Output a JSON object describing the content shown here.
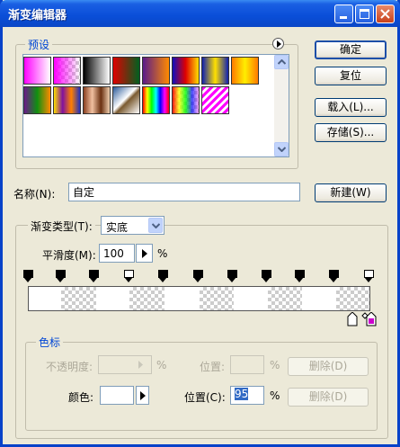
{
  "window": {
    "title": "渐变编辑器"
  },
  "presets": {
    "label": "预设",
    "swatches": [
      {
        "name": "magenta-white"
      },
      {
        "name": "magenta-transparent"
      },
      {
        "name": "black-white"
      },
      {
        "name": "red-green"
      },
      {
        "name": "violet-orange"
      },
      {
        "name": "blue-red-yellow"
      },
      {
        "name": "blue-yellow-blue"
      },
      {
        "name": "orange-yellow-orange"
      },
      {
        "name": "violet-green-orange"
      },
      {
        "name": "yellow-violet-orange-blue"
      },
      {
        "name": "copper"
      },
      {
        "name": "chrome"
      },
      {
        "name": "spectrum"
      },
      {
        "name": "transparent-rainbow"
      },
      {
        "name": "transparent-stripes"
      }
    ]
  },
  "buttons": {
    "ok": "确定",
    "reset": "复位",
    "load": "载入(L)...",
    "save": "存储(S)...",
    "new": "新建(W)"
  },
  "name": {
    "label": "名称(N):",
    "value": "自定"
  },
  "gradient_type": {
    "label": "渐变类型(T):",
    "value": "实底"
  },
  "smoothness": {
    "label": "平滑度(M):",
    "value": "100",
    "unit": "%"
  },
  "color_stops": {
    "label": "色标",
    "opacity_label": "不透明度:",
    "opacity_unit": "%",
    "opacity_location_label": "位置:",
    "opacity_location_unit": "%",
    "opacity_delete": "删除(D)",
    "color_label": "颜色:",
    "location_label": "位置(C):",
    "location_value": "95",
    "location_unit": "%",
    "color_delete": "删除(D)"
  },
  "colors": {
    "accent": "#0046d5",
    "titlebar": "#0a4ed8",
    "stop_selected": "#cc00cc"
  }
}
